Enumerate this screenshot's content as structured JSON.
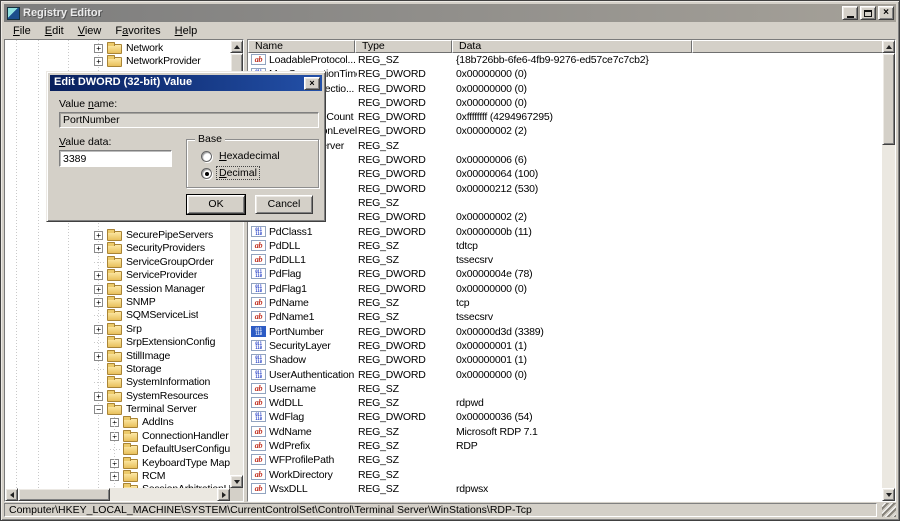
{
  "window": {
    "title": "Registry Editor",
    "controls": [
      {
        "name": "minimize-button",
        "icon": "minimize-icon"
      },
      {
        "name": "maximize-button",
        "icon": "maximize-icon"
      },
      {
        "name": "close-button",
        "icon": "close-icon",
        "glyph": "x"
      }
    ]
  },
  "menu": {
    "items": [
      {
        "text": "File",
        "accel": 0
      },
      {
        "text": "Edit",
        "accel": 0
      },
      {
        "text": "View",
        "accel": 0
      },
      {
        "text": "Favorites",
        "accel": 1
      },
      {
        "text": "Help",
        "accel": 0
      }
    ]
  },
  "tree": {
    "top_items": [
      {
        "label": "Network",
        "level": 0,
        "exp": "plus"
      },
      {
        "label": "NetworkProvider",
        "level": 0,
        "exp": "plus"
      }
    ],
    "items": [
      {
        "label": "SecurePipeServers",
        "level": 0,
        "exp": "plus"
      },
      {
        "label": "SecurityProviders",
        "level": 0,
        "exp": "plus"
      },
      {
        "label": "ServiceGroupOrder",
        "level": 0,
        "exp": "none"
      },
      {
        "label": "ServiceProvider",
        "level": 0,
        "exp": "plus"
      },
      {
        "label": "Session Manager",
        "level": 0,
        "exp": "plus"
      },
      {
        "label": "SNMP",
        "level": 0,
        "exp": "plus"
      },
      {
        "label": "SQMServiceList",
        "level": 0,
        "exp": "none"
      },
      {
        "label": "Srp",
        "level": 0,
        "exp": "plus"
      },
      {
        "label": "SrpExtensionConfig",
        "level": 0,
        "exp": "none"
      },
      {
        "label": "StillImage",
        "level": 0,
        "exp": "plus"
      },
      {
        "label": "Storage",
        "level": 0,
        "exp": "none"
      },
      {
        "label": "SystemInformation",
        "level": 0,
        "exp": "none"
      },
      {
        "label": "SystemResources",
        "level": 0,
        "exp": "plus"
      },
      {
        "label": "Terminal Server",
        "level": 0,
        "exp": "minus",
        "open": true
      },
      {
        "label": "AddIns",
        "level": 1,
        "exp": "plus"
      },
      {
        "label": "ConnectionHandler",
        "level": 1,
        "exp": "plus"
      },
      {
        "label": "DefaultUserConfiguration",
        "level": 1,
        "exp": "none"
      },
      {
        "label": "KeyboardType Mapping",
        "level": 1,
        "exp": "plus"
      },
      {
        "label": "RCM",
        "level": 1,
        "exp": "plus"
      },
      {
        "label": "SessionArbitrationHelpe",
        "level": 1,
        "exp": "none"
      }
    ]
  },
  "list": {
    "columns": [
      "Name",
      "Type",
      "Data"
    ],
    "rows": [
      {
        "name": "LoadableProtocol...",
        "type": "REG_SZ",
        "data": "{18b726bb-6fe6-4fb9-9276-ed57ce7c7cb2}",
        "icon": "sz"
      },
      {
        "name": "MaxConnectionTime",
        "type": "REG_DWORD",
        "data": "0x00000000 (0)",
        "icon": "dword"
      },
      {
        "name": "MaxDisconnectio...",
        "type": "REG_DWORD",
        "data": "0x00000000 (0)",
        "icon": "dword"
      },
      {
        "name": "",
        "type": "REG_DWORD",
        "data": "0x00000000 (0)",
        "icon": "dword"
      },
      {
        "name": "MaxInstanceCount",
        "type": "REG_DWORD",
        "data": "0xffffffff (4294967295)",
        "icon": "dword"
      },
      {
        "name": "MinEncryptionLevel",
        "type": "REG_DWORD",
        "data": "0x00000002 (2)",
        "icon": "dword"
      },
      {
        "name": "NWLogonServer",
        "type": "REG_SZ",
        "data": "",
        "icon": "sz"
      },
      {
        "name": "",
        "type": "REG_DWORD",
        "data": "0x00000006 (6)",
        "icon": "dword"
      },
      {
        "name": "",
        "type": "REG_DWORD",
        "data": "0x00000064 (100)",
        "icon": "dword"
      },
      {
        "name": "",
        "type": "REG_DWORD",
        "data": "0x00000212 (530)",
        "icon": "dword"
      },
      {
        "name": "",
        "type": "REG_SZ",
        "data": "",
        "icon": "sz"
      },
      {
        "name": "",
        "type": "REG_DWORD",
        "data": "0x00000002 (2)",
        "icon": "dword"
      },
      {
        "name": "PdClass1",
        "type": "REG_DWORD",
        "data": "0x0000000b (11)",
        "icon": "dword"
      },
      {
        "name": "PdDLL",
        "type": "REG_SZ",
        "data": "tdtcp",
        "icon": "sz"
      },
      {
        "name": "PdDLL1",
        "type": "REG_SZ",
        "data": "tssecsrv",
        "icon": "sz"
      },
      {
        "name": "PdFlag",
        "type": "REG_DWORD",
        "data": "0x0000004e (78)",
        "icon": "dword"
      },
      {
        "name": "PdFlag1",
        "type": "REG_DWORD",
        "data": "0x00000000 (0)",
        "icon": "dword"
      },
      {
        "name": "PdName",
        "type": "REG_SZ",
        "data": "tcp",
        "icon": "sz"
      },
      {
        "name": "PdName1",
        "type": "REG_SZ",
        "data": "tssecsrv",
        "icon": "sz"
      },
      {
        "name": "PortNumber",
        "type": "REG_DWORD",
        "data": "0x00000d3d (3389)",
        "icon": "dword",
        "selected": true
      },
      {
        "name": "SecurityLayer",
        "type": "REG_DWORD",
        "data": "0x00000001 (1)",
        "icon": "dword"
      },
      {
        "name": "Shadow",
        "type": "REG_DWORD",
        "data": "0x00000001 (1)",
        "icon": "dword"
      },
      {
        "name": "UserAuthentication",
        "type": "REG_DWORD",
        "data": "0x00000000 (0)",
        "icon": "dword"
      },
      {
        "name": "Username",
        "type": "REG_SZ",
        "data": "",
        "icon": "sz"
      },
      {
        "name": "WdDLL",
        "type": "REG_SZ",
        "data": "rdpwd",
        "icon": "sz"
      },
      {
        "name": "WdFlag",
        "type": "REG_DWORD",
        "data": "0x00000036 (54)",
        "icon": "dword"
      },
      {
        "name": "WdName",
        "type": "REG_SZ",
        "data": "Microsoft RDP 7.1",
        "icon": "sz"
      },
      {
        "name": "WdPrefix",
        "type": "REG_SZ",
        "data": "RDP",
        "icon": "sz"
      },
      {
        "name": "WFProfilePath",
        "type": "REG_SZ",
        "data": "",
        "icon": "sz"
      },
      {
        "name": "WorkDirectory",
        "type": "REG_SZ",
        "data": "",
        "icon": "sz"
      },
      {
        "name": "WsxDLL",
        "type": "REG_SZ",
        "data": "rdpwsx",
        "icon": "sz"
      }
    ]
  },
  "dialog": {
    "title": "Edit DWORD (32-bit) Value",
    "value_name_label": {
      "text": "Value name:",
      "accel": 6
    },
    "value_name": "PortNumber",
    "value_data_label": {
      "text": "Value data:",
      "accel": 0
    },
    "value_data": "3389",
    "base_group_label": "Base",
    "radios": [
      {
        "label": {
          "text": "Hexadecimal",
          "accel": 0
        },
        "selected": false
      },
      {
        "label": {
          "text": "Decimal",
          "accel": 0
        },
        "selected": true
      }
    ],
    "ok_label": "OK",
    "cancel_label": "Cancel",
    "close_glyph": "x"
  },
  "status_bar": {
    "path": "Computer\\HKEY_LOCAL_MACHINE\\SYSTEM\\CurrentControlSet\\Control\\Terminal Server\\WinStations\\RDP-Tcp"
  },
  "icons": {
    "string_value_glyph": "ab",
    "dword_value_glyph_rows": [
      "011",
      "110"
    ]
  },
  "colors": {
    "chrome": "#d4d0c8",
    "inactive_titlebar": "#7d7d7d",
    "dialog_titlebar": "#081f5c",
    "selection": "#2c5bc4",
    "folder": "#e8c05c",
    "reg_sz_icon": "#c03426",
    "reg_dword_icon": "#2741c6"
  }
}
